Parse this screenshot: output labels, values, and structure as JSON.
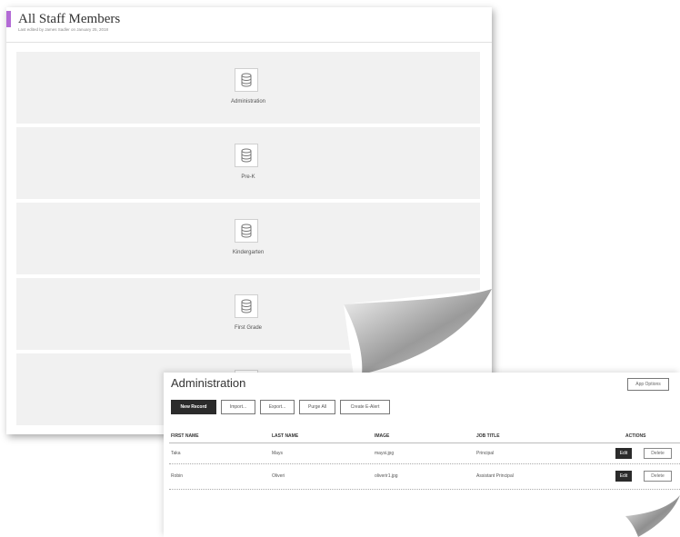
{
  "staff_page": {
    "title": "All Staff Members",
    "subtitle": "Last edited by James Sadler on January 25, 2018",
    "categories": [
      {
        "label": "Administration",
        "icon": "database-icon"
      },
      {
        "label": "Pre-K",
        "icon": "database-icon"
      },
      {
        "label": "Kindergarten",
        "icon": "database-icon"
      },
      {
        "label": "First Grade",
        "icon": "database-icon"
      },
      {
        "label": "",
        "icon": "database-icon"
      }
    ]
  },
  "admin_page": {
    "title": "Administration",
    "app_options": "App Options",
    "toolbar": {
      "new_record": "New Record",
      "import": "Import...",
      "export": "Export...",
      "purge_all": "Purge All",
      "create_alert": "Create E-Alert"
    },
    "columns": [
      "FIRST NAME",
      "LAST NAME",
      "IMAGE",
      "JOB TITLE",
      "ACTIONS"
    ],
    "rows": [
      {
        "first": "Taka",
        "last": "Mays",
        "image": "maysi.jpg",
        "job": "Principal",
        "edit": "Edit",
        "delete": "Delete"
      },
      {
        "first": "Robin",
        "last": "Oliveri",
        "image": "oliverir1.jpg",
        "job": "Assistant Principal",
        "edit": "Edit",
        "delete": "Delete"
      }
    ]
  },
  "colors": {
    "accent": "#b36bd6",
    "tile_bg": "#f1f1f1",
    "dark_button": "#2b2b2b"
  }
}
